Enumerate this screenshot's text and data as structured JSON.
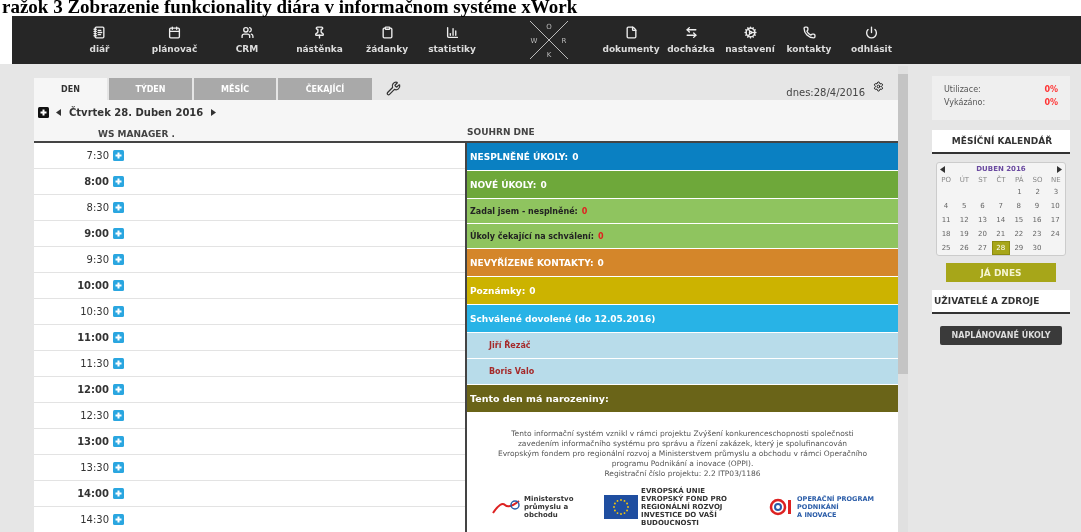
{
  "caption": "ražok 3 Zobrazenie funkcionality diára v informačnom systéme xWork",
  "nav_left": [
    {
      "label": "diář"
    },
    {
      "label": "plánovač"
    },
    {
      "label": "CRM"
    },
    {
      "label": "nástěnka"
    },
    {
      "label": "žádanky"
    },
    {
      "label": "statistiky"
    }
  ],
  "logo": {
    "top": "O",
    "left": "W",
    "right": "R",
    "bottom": "K"
  },
  "nav_right": [
    {
      "label": "dokumenty"
    },
    {
      "label": "docházka"
    },
    {
      "label": "nastavení"
    },
    {
      "label": "kontakty"
    },
    {
      "label": "odhlásit"
    }
  ],
  "tabs": [
    {
      "label": "DEN",
      "selected": true
    },
    {
      "label": "TÝDEN",
      "selected": false
    },
    {
      "label": "MĚSÍC",
      "selected": false
    },
    {
      "label": "ČEKAJÍCÍ",
      "selected": false
    }
  ],
  "today": "dnes:28/4/2016",
  "date": "Čtvrtek 28. Duben 2016",
  "columns": [
    "WS MANAGER .",
    "SOUHRN DNE"
  ],
  "times": [
    {
      "time": "7:30",
      "bold": false
    },
    {
      "time": "8:00",
      "bold": true
    },
    {
      "time": "8:30",
      "bold": false
    },
    {
      "time": "9:00",
      "bold": true
    },
    {
      "time": "9:30",
      "bold": false
    },
    {
      "time": "10:00",
      "bold": true
    },
    {
      "time": "10:30",
      "bold": false
    },
    {
      "time": "11:00",
      "bold": true
    },
    {
      "time": "11:30",
      "bold": false
    },
    {
      "time": "12:00",
      "bold": true
    },
    {
      "time": "12:30",
      "bold": false
    },
    {
      "time": "13:00",
      "bold": true
    },
    {
      "time": "13:30",
      "bold": false
    },
    {
      "time": "14:00",
      "bold": true
    },
    {
      "time": "14:30",
      "bold": false
    }
  ],
  "summary": [
    {
      "kind": "header",
      "label": "NESPLNĚNÉ ÚKOLY:",
      "count": "0",
      "color": "#0a80c2"
    },
    {
      "kind": "header",
      "label": "NOVÉ ÚKOLY:",
      "count": "0",
      "color": "#6ea83a"
    },
    {
      "kind": "sub",
      "label": "Zadal jsem - nesplněné:",
      "count": "0",
      "color": "#8fc45f"
    },
    {
      "kind": "sub",
      "label": "Úkoly čekající na schválení:",
      "count": "0",
      "color": "#8fc45f"
    },
    {
      "kind": "header",
      "label": "NEVYŘÍZENÉ KONTAKTY:",
      "count": "0",
      "color": "#d4862a"
    },
    {
      "kind": "header",
      "label": "Poznámky:",
      "count": "0",
      "color": "#ccb300"
    },
    {
      "kind": "header",
      "label": "Schválené dovolené (do 12.05.2016)",
      "color": "#28b3e6"
    },
    {
      "kind": "person",
      "label": "Jiří Řezáč",
      "color": "#b8dcea"
    },
    {
      "kind": "person",
      "label": "Boris Valo",
      "color": "#b8dcea"
    },
    {
      "kind": "title",
      "label": "Tento den má narozeniny:",
      "color": "#6a6418"
    }
  ],
  "footer": {
    "text": "Tento informační systém vznikl v rámci projektu Zvýšení konkurenceschopnosti společnosti zavedením informačního systému pro správu a řízení zakázek, který je spolufinancován Evropským fondem pro regionální rozvoj a Ministerstvem průmyslu a obchodu v rámci Operačního programu Podnikání a inovace (OPPI).",
    "registration": "Registrační číslo projektu: 2.2 ITP03/1186",
    "mpo": "Ministerstvo průmyslu a obchodu",
    "eu": [
      "EVROPSKÁ UNIE",
      "EVROPSKÝ FOND PRO REGIONÁLNÍ ROZVOJ",
      "INVESTICE DO VAŠÍ BUDOUCNOSTI"
    ],
    "oppi": [
      "OPERAČNÍ PROGRAM",
      "PODNIKÁNÍ",
      "A INOVACE"
    ]
  },
  "stats": [
    {
      "label": "Utilizace:",
      "value": "0%"
    },
    {
      "label": "Vykázáno:",
      "value": "0%"
    }
  ],
  "calendar": {
    "heading": "MĚSÍČNÍ KALENDÁŘ",
    "month": "DUBEN 2016",
    "weekdays": [
      "PO",
      "ÚT",
      "ST",
      "ČT",
      "PÁ",
      "SO",
      "NE"
    ],
    "weeks": [
      {
        "days": [
          {
            "day": "1",
            "selected": false
          },
          {
            "day": "2",
            "selected": false
          },
          {
            "day": "3",
            "selected": false
          }
        ]
      },
      {
        "days": [
          {
            "day": "4",
            "selected": false
          },
          {
            "day": "5",
            "selected": false
          },
          {
            "day": "6",
            "selected": false
          },
          {
            "day": "7",
            "selected": false
          },
          {
            "day": "8",
            "selected": false
          },
          {
            "day": "9",
            "selected": false
          },
          {
            "day": "10",
            "selected": false
          }
        ]
      },
      {
        "days": [
          {
            "day": "11",
            "selected": false
          },
          {
            "day": "12",
            "selected": false
          },
          {
            "day": "13",
            "selected": false
          },
          {
            "day": "14",
            "selected": false
          },
          {
            "day": "15",
            "selected": false
          },
          {
            "day": "16",
            "selected": false
          },
          {
            "day": "17",
            "selected": false
          }
        ]
      },
      {
        "days": [
          {
            "day": "18",
            "selected": false
          },
          {
            "day": "19",
            "selected": false
          },
          {
            "day": "20",
            "selected": false
          },
          {
            "day": "21",
            "selected": false
          },
          {
            "day": "22",
            "selected": false
          },
          {
            "day": "23",
            "selected": false
          },
          {
            "day": "24",
            "selected": false
          }
        ]
      },
      {
        "days": [
          {
            "day": "25",
            "selected": false
          },
          {
            "day": "26",
            "selected": false
          },
          {
            "day": "27",
            "selected": false
          },
          {
            "day": "28",
            "selected": true
          },
          {
            "day": "29",
            "selected": false
          },
          {
            "day": "30",
            "selected": false
          }
        ]
      }
    ],
    "today_button": "JÁ DNES"
  },
  "resources_heading": "UŽIVATELÉ A ZDROJE",
  "planned_button": "NAPLÁNOVANÉ ÚKOLY"
}
